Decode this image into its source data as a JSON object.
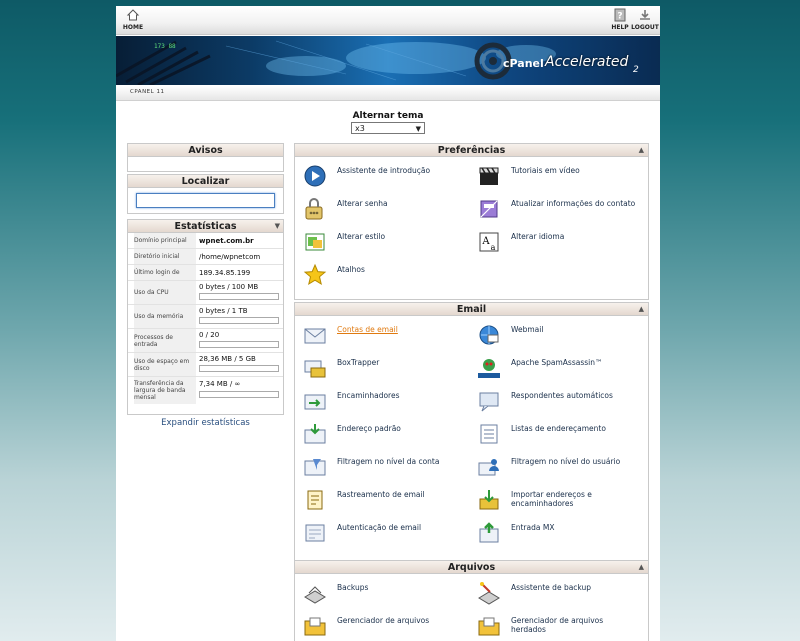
{
  "nav": {
    "home_label": "HOME",
    "help_label": "HELP",
    "logout_label": "LOGOUT"
  },
  "banner": {
    "brand": "cPanel",
    "product": "Accelerated",
    "version": "2"
  },
  "tabbar": {
    "tab_label": "CPANEL 11"
  },
  "theme": {
    "label": "Alternar tema",
    "selected": "x3"
  },
  "avisos": {
    "title": "Avisos"
  },
  "localizar": {
    "title": "Localizar",
    "search_value": ""
  },
  "stats": {
    "title": "Estatísticas",
    "rows": [
      {
        "label": "Domínio principal",
        "value": "wpnet.com.br"
      },
      {
        "label": "Diretório inicial",
        "value": "/home/wpnetcom"
      },
      {
        "label": "Último login de",
        "value": "189.34.85.199"
      },
      {
        "label": "Uso da CPU",
        "value": "0 bytes / 100 MB",
        "fill": 0
      },
      {
        "label": "Uso da memória",
        "value": "0 bytes / 1 TB",
        "fill": 0
      },
      {
        "label": "Processos de entrada",
        "value": "0 / 20",
        "fill": 0
      },
      {
        "label": "Uso de espaço em disco",
        "value": "28,36 MB / 5 GB",
        "fill": 0.006
      },
      {
        "label": "Transferência da largura de banda mensal",
        "value": "7,34 MB / ∞",
        "fill": 0
      }
    ],
    "expand_label": "Expandir estatísticas"
  },
  "preferencias": {
    "title": "Preferências",
    "items": [
      {
        "label": "Assistente de introdução",
        "icon": "play-icon"
      },
      {
        "label": "Tutoriais em vídeo",
        "icon": "clapper-icon"
      },
      {
        "label": "Alterar senha",
        "icon": "password-icon"
      },
      {
        "label": "Atualizar informações do contato",
        "icon": "contact-icon"
      },
      {
        "label": "Alterar estilo",
        "icon": "style-icon"
      },
      {
        "label": "Alterar idioma",
        "icon": "language-icon"
      },
      {
        "label": "Atalhos",
        "icon": "star-icon"
      }
    ]
  },
  "email": {
    "title": "Email",
    "items": [
      {
        "label": "Contas de email",
        "icon": "envelope-icon",
        "highlight": true
      },
      {
        "label": "Webmail",
        "icon": "webmail-icon"
      },
      {
        "label": "BoxTrapper",
        "icon": "boxtrapper-icon"
      },
      {
        "label": "Apache SpamAssassin™",
        "icon": "spamassassin-icon"
      },
      {
        "label": "Encaminhadores",
        "icon": "forwarder-icon"
      },
      {
        "label": "Respondentes automáticos",
        "icon": "autoresponder-icon"
      },
      {
        "label": "Endereço padrão",
        "icon": "default-address-icon"
      },
      {
        "label": "Listas de endereçamento",
        "icon": "mailing-list-icon"
      },
      {
        "label": "Filtragem no nível da conta",
        "icon": "account-filter-icon"
      },
      {
        "label": "Filtragem no nível do usuário",
        "icon": "user-filter-icon"
      },
      {
        "label": "Rastreamento de email",
        "icon": "email-trace-icon"
      },
      {
        "label": "Importar endereços e encaminhadores",
        "icon": "import-icon"
      },
      {
        "label": "Autenticação de email",
        "icon": "authentication-icon"
      },
      {
        "label": "Entrada MX",
        "icon": "mx-entry-icon"
      }
    ]
  },
  "arquivos": {
    "title": "Arquivos",
    "items": [
      {
        "label": "Backups",
        "icon": "backup-icon"
      },
      {
        "label": "Assistente de backup",
        "icon": "backup-wizard-icon"
      },
      {
        "label": "Gerenciador de arquivos",
        "icon": "file-manager-icon"
      },
      {
        "label": "Gerenciador de arquivos herdados",
        "icon": "legacy-file-manager-icon"
      }
    ]
  },
  "colors": {
    "link": "#1a2f4a",
    "highlight": "#e07a10",
    "header_bg": "#e4d8cf"
  }
}
